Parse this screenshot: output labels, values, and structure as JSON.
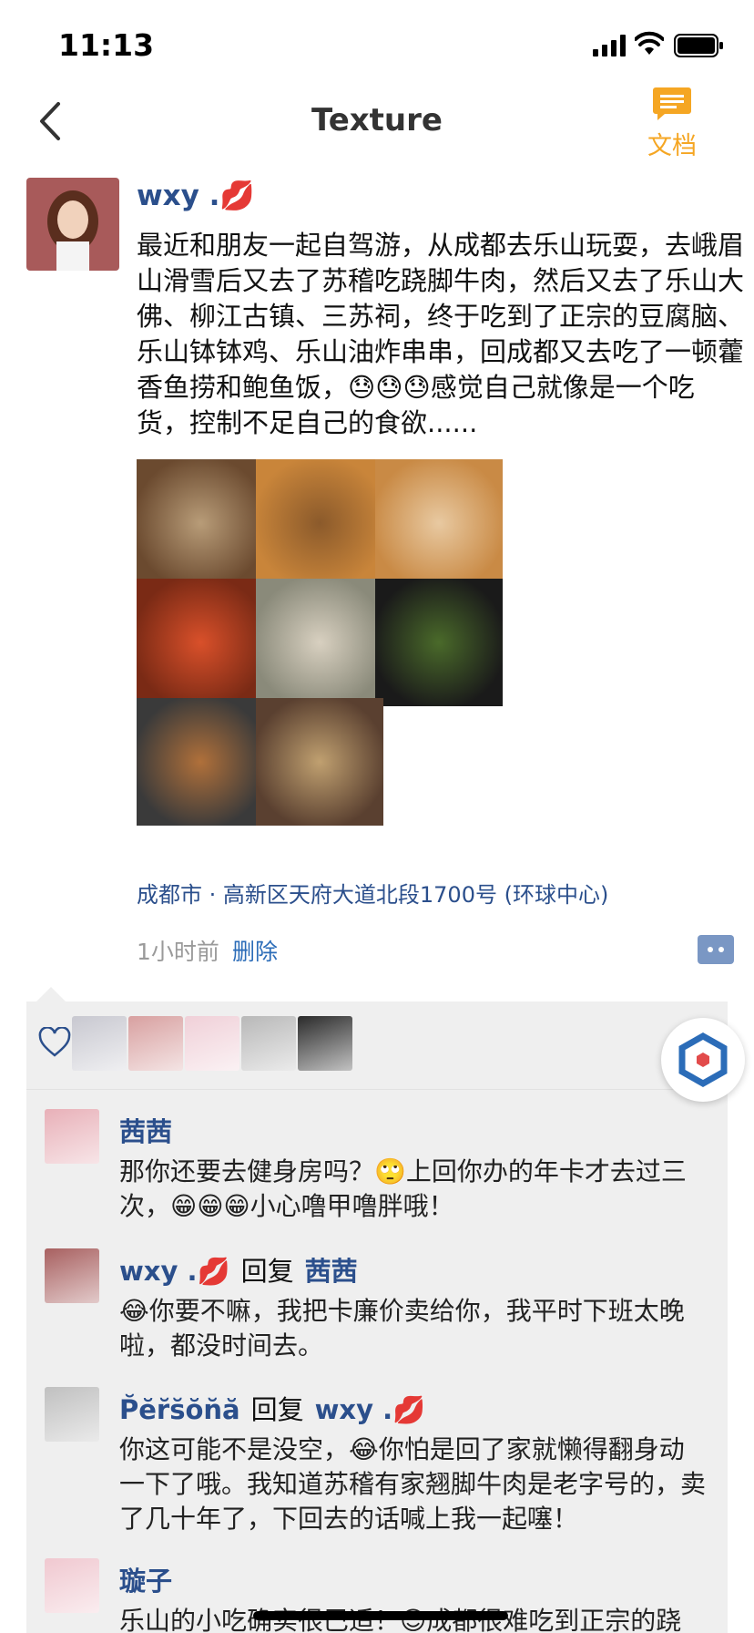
{
  "status_bar": {
    "time": "11:13"
  },
  "nav": {
    "title": "Texture",
    "doc_label": "文档"
  },
  "post": {
    "author": "wxy .💋",
    "text": "最近和朋友一起自驾游，从成都去乐山玩耍，去峨眉山滑雪后又去了苏稽吃跷脚牛肉，然后又去了乐山大佛、柳江古镇、三苏祠，终于吃到了正宗的豆腐脑、乐山钵钵鸡、乐山油炸串串，回成都又去吃了一顿藿香鱼捞和鲍鱼饭，😓😓😓感觉自己就像是一个吃货，控制不足自己的食欲......",
    "photos": [
      {
        "name": "photo-mushroom-soup",
        "color1": "#6b4a2f",
        "color2": "#b89c78"
      },
      {
        "name": "photo-skewers-plate",
        "color1": "#c9853a",
        "color2": "#8b5a2b"
      },
      {
        "name": "photo-fried-pork",
        "color1": "#c98a45",
        "color2": "#e8c9a1"
      },
      {
        "name": "photo-chili-skewers",
        "color1": "#7a2a15",
        "color2": "#d9502a"
      },
      {
        "name": "photo-noodle-soup",
        "color1": "#8a8a7a",
        "color2": "#d8d0c0"
      },
      {
        "name": "photo-hotpot-dark",
        "color1": "#1a1a1a",
        "color2": "#4a6a2a"
      },
      {
        "name": "photo-skewer-circle",
        "color1": "#3a3a3a",
        "color2": "#b0703a"
      },
      {
        "name": "photo-table-dishes",
        "color1": "#5a4030",
        "color2": "#c0a070"
      }
    ],
    "location": "成都市 · 高新区天府大道北段1700号 (环球中心)",
    "time_ago": "1小时前",
    "delete_label": "删除"
  },
  "likes": {
    "avatars": [
      {
        "name": "like-avatar-1",
        "color": "#c8c8d0"
      },
      {
        "name": "like-avatar-2",
        "color": "#d8a0a0"
      },
      {
        "name": "like-avatar-3",
        "color": "#f0d0d8"
      },
      {
        "name": "like-avatar-4",
        "color": "#b8b8b8"
      },
      {
        "name": "like-avatar-5",
        "color": "#2a2a2a"
      }
    ]
  },
  "comments": [
    {
      "author": "茜茜",
      "reply_label": "",
      "reply_to": "",
      "text": "那你还要去健身房吗？🙄上回你办的年卡才去过三次，😁😁😁小心噜甲噜胖哦！",
      "avatar_color": "#e8b0b8"
    },
    {
      "author": "wxy .💋",
      "reply_label": "回复",
      "reply_to": "茜茜",
      "text": "😂你要不嘛，我把卡廉价卖给你，我平时下班太晚啦，都没时间去。",
      "avatar_color": "#a86060"
    },
    {
      "author": "P̆ĕr̆s̆ŏn̆ă",
      "reply_label": "回复",
      "reply_to": "wxy .💋",
      "text": "你这可能不是没空，😂你怕是回了家就懒得翻身动一下了哦。我知道苏稽有家翘脚牛肉是老字号的，卖了几十年了，下回去的话喊上我一起噻！",
      "avatar_color": "#c0c0c0"
    },
    {
      "author": "璇子",
      "reply_label": "",
      "reply_to": "",
      "text": "乐山的小吃确实很巴适！😊成都很难吃到正宗的跷",
      "avatar_color": "#f0c8d0"
    }
  ],
  "colors": {
    "link": "#2b4f8c",
    "accent": "#f5a623",
    "panel": "#efefef"
  }
}
